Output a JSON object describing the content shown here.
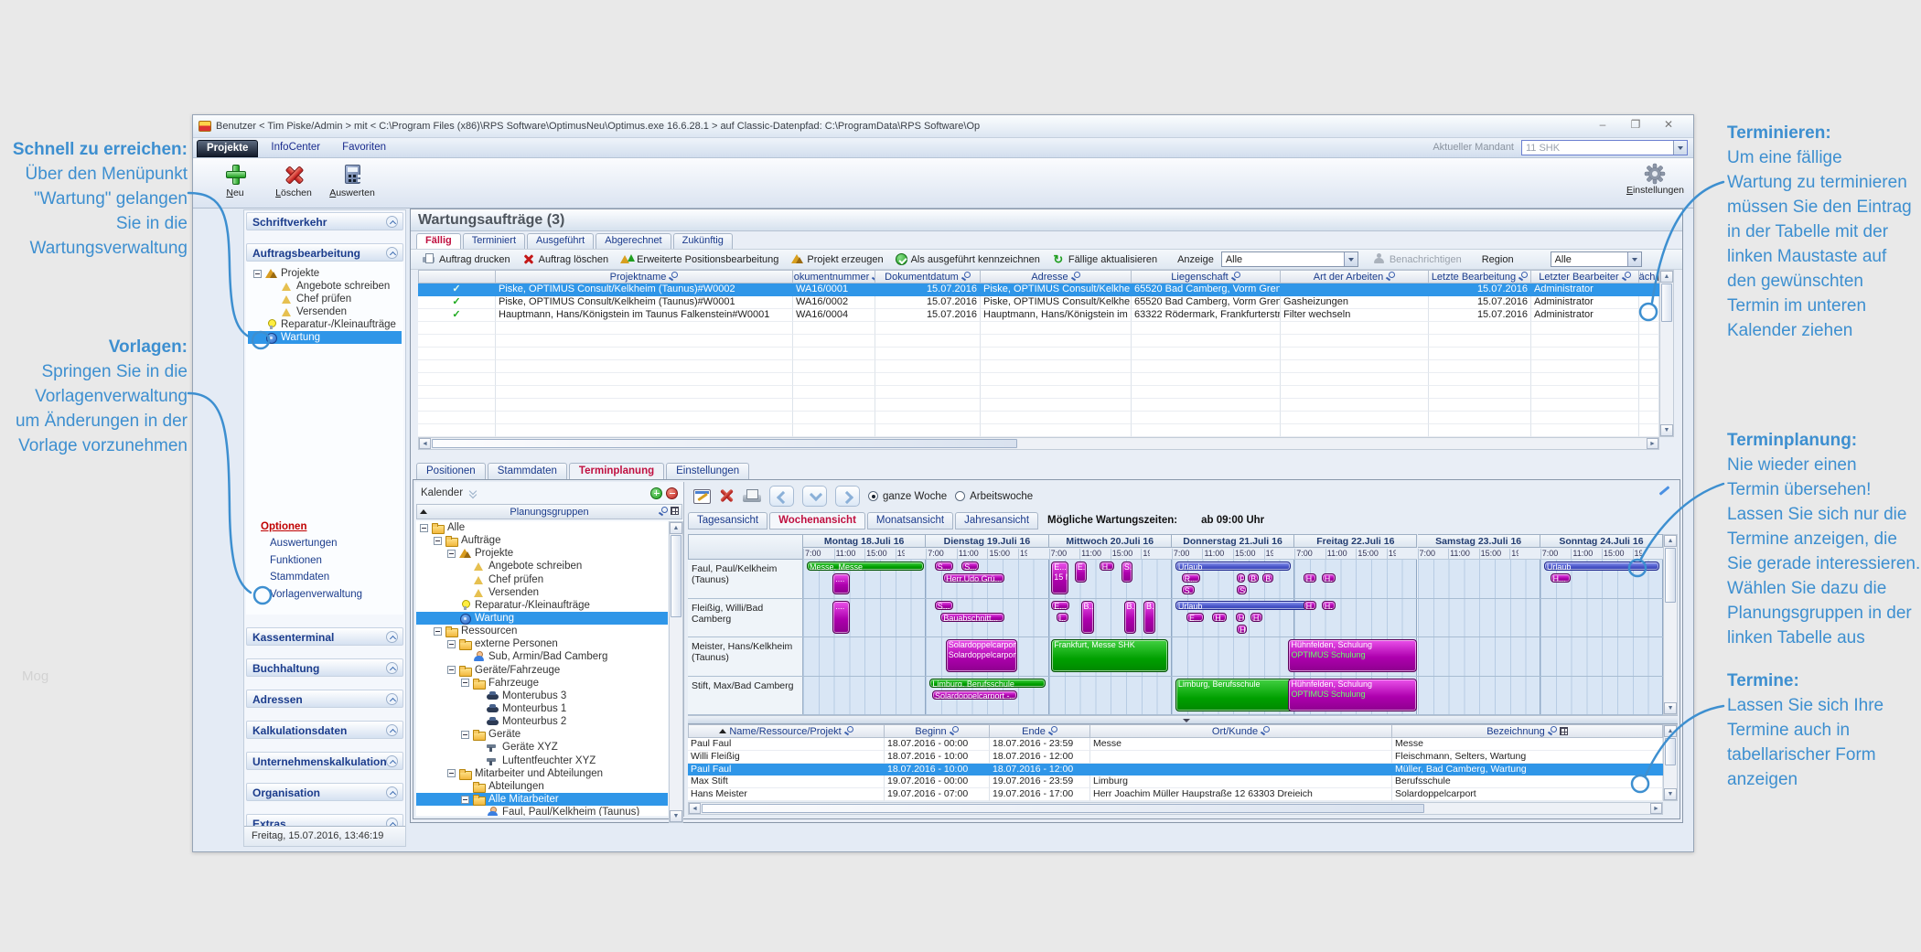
{
  "watermark": "Mog",
  "colors": {
    "annotation_blue": "#3d8fd0",
    "selection_blue": "#2f96e8",
    "active_tab_red": "#c01040",
    "event_green": "#00a000",
    "event_magenta": "#ae00ae",
    "event_vacation_blue": "#4854c8"
  },
  "annotations": {
    "left": [
      {
        "title": "Schnell zu erreichen:",
        "lines": [
          "Über den Menüpunkt",
          "\"Wartung\" gelangen",
          "Sie in die",
          "Wartungsverwaltung"
        ]
      },
      {
        "title": "Vorlagen:",
        "lines": [
          "Springen Sie in die",
          "Vorlagenverwaltung",
          "um Änderungen in der",
          "Vorlage vorzunehmen"
        ]
      }
    ],
    "right": [
      {
        "title": "Terminieren:",
        "lines": [
          "Um eine fällige",
          "Wartung zu terminieren",
          "müssen Sie den Eintrag",
          "in der Tabelle mit der",
          "linken Maustaste auf",
          "den gewünschten",
          "Termin im unteren",
          "Kalender ziehen"
        ]
      },
      {
        "title": "Terminplanung:",
        "lines": [
          "Nie wieder einen",
          "Termin übersehen!",
          "Lassen Sie sich nur die",
          "Termine anzeigen, die",
          "Sie gerade interessieren.",
          "Wählen Sie dazu die",
          "Planungsgruppen in der",
          "linken Tabelle aus"
        ]
      },
      {
        "title": "Termine:",
        "lines": [
          "Lassen Sie sich Ihre",
          "Termine auch in",
          "tabellarischer Form",
          "anzeigen"
        ]
      }
    ]
  },
  "window": {
    "title": "Benutzer < Tim Piske/Admin > mit < C:\\Program Files (x86)\\RPS Software\\OptimusNeu\\Optimus.exe 16.6.28.1 > auf Classic-Datenpfad: C:\\ProgramData\\RPS Software\\Op",
    "menu": [
      "Projekte",
      "InfoCenter",
      "Favoriten"
    ],
    "mandant_label": "Aktueller Mandant",
    "mandant_value": "11 SHK",
    "toolbar": [
      "Neu",
      "Löschen",
      "Auswerten"
    ],
    "settings_label": "Einstellungen"
  },
  "sidebar": {
    "section_top1": "Schriftverkehr",
    "section_top2": "Auftragsbearbeitung",
    "tree": [
      {
        "depth": 0,
        "icon": "project",
        "label": "Projekte",
        "expander": true
      },
      {
        "depth": 1,
        "icon": "doc",
        "label": "Angebote schreiben"
      },
      {
        "depth": 1,
        "icon": "doc",
        "label": "Chef prüfen"
      },
      {
        "depth": 1,
        "icon": "doc",
        "label": "Versenden"
      },
      {
        "depth": 0,
        "icon": "bulb",
        "label": "Reparatur-/Kleinaufträge"
      },
      {
        "depth": 0,
        "icon": "puzzle",
        "label": "Wartung",
        "selected": true
      }
    ],
    "options_title": "Optionen",
    "options": [
      "Auswertungen",
      "Funktionen",
      "Stammdaten",
      "Vorlagenverwaltung"
    ],
    "sections": [
      "Kassenterminal",
      "Buchhaltung",
      "Adressen",
      "Kalkulationsdaten",
      "Unternehmenskalkulation",
      "Organisation",
      "Extras"
    ],
    "status": "Freitag, 15.07.2016, 13:46:19"
  },
  "main": {
    "title": "Wartungsaufträge (3)",
    "filter_tabs": [
      {
        "label": "Fällig",
        "active": true
      },
      {
        "label": "Terminiert"
      },
      {
        "label": "Ausgeführt"
      },
      {
        "label": "Abgerechnet"
      },
      {
        "label": "Zukünftig"
      }
    ],
    "actions": [
      "Auftrag drucken",
      "Auftrag löschen",
      "Erweiterte Positionsbearbeitung",
      "Projekt erzeugen",
      "Als ausgeführt kennzeichnen",
      "Fällige aktualisieren"
    ],
    "anzeige_label": "Anzeige",
    "anzeige_value": "Alle",
    "benachrichtigen_label": "Benachrichtigen",
    "region_label": "Region",
    "region_value": "Alle",
    "table": {
      "columns": [
        "",
        "Projektname",
        "Dokumentnummer",
        "Dokumentdatum",
        "Adresse",
        "Liegenschaft",
        "Art der Arbeiten",
        "Letzte Bearbeitung",
        "Letzter Bearbeiter",
        "Näch"
      ],
      "rows": [
        {
          "selected": true,
          "cells": [
            "Piske, OPTIMUS Consult/Kelkheim (Taunus)#W0002",
            "WA16/0001",
            "15.07.2016",
            "Piske, OPTIMUS Consult/Kelkhe",
            "65520 Bad Camberg, Vorm Grenz",
            "",
            "15.07.2016",
            "Administrator",
            ""
          ]
        },
        {
          "cells": [
            "Piske, OPTIMUS Consult/Kelkheim (Taunus)#W0001",
            "WA16/0002",
            "15.07.2016",
            "Piske, OPTIMUS Consult/Kelkhe",
            "65520 Bad Camberg, Vorm Grenz",
            "Gasheizungen",
            "15.07.2016",
            "Administrator",
            ""
          ]
        },
        {
          "cells": [
            "Hauptmann, Hans/Königstein im Taunus Falkenstein#W0001",
            "WA16/0004",
            "15.07.2016",
            "Hauptmann, Hans/Königstein im",
            "63322 Rödermark, Frankfurterstra",
            "Filter wechseln",
            "15.07.2016",
            "Administrator",
            ""
          ]
        }
      ]
    }
  },
  "workspace": {
    "tabs": [
      {
        "label": "Positionen"
      },
      {
        "label": "Stammdaten"
      },
      {
        "label": "Terminplanung",
        "active": true
      },
      {
        "label": "Einstellungen"
      }
    ],
    "kalender_label": "Kalender",
    "groups_header": "Planungsgruppen",
    "groups_tree": [
      {
        "depth": 0,
        "icon": "folder",
        "label": "Alle",
        "expander": true
      },
      {
        "depth": 1,
        "icon": "folder",
        "label": "Aufträge",
        "expander": true
      },
      {
        "depth": 2,
        "icon": "project",
        "label": "Projekte",
        "expander": true
      },
      {
        "depth": 3,
        "icon": "doc",
        "label": "Angebote schreiben"
      },
      {
        "depth": 3,
        "icon": "doc",
        "label": "Chef prüfen"
      },
      {
        "depth": 3,
        "icon": "doc",
        "label": "Versenden"
      },
      {
        "depth": 2,
        "icon": "bulb",
        "label": "Reparatur-/Kleinaufträge"
      },
      {
        "depth": 2,
        "icon": "puzzle",
        "label": "Wartung",
        "selected": true
      },
      {
        "depth": 1,
        "icon": "folder",
        "label": "Ressourcen",
        "expander": true
      },
      {
        "depth": 2,
        "icon": "folder",
        "label": "externe Personen",
        "expander": true
      },
      {
        "depth": 3,
        "icon": "person",
        "label": "Sub, Armin/Bad Camberg"
      },
      {
        "depth": 2,
        "icon": "folder",
        "label": "Geräte/Fahrzeuge",
        "expander": true
      },
      {
        "depth": 3,
        "icon": "folder",
        "label": "Fahrzeuge",
        "expander": true
      },
      {
        "depth": 4,
        "icon": "car",
        "label": "Monterubus 3"
      },
      {
        "depth": 4,
        "icon": "car",
        "label": "Monteurbus 1"
      },
      {
        "depth": 4,
        "icon": "car",
        "label": "Monteurbus 2"
      },
      {
        "depth": 3,
        "icon": "folder",
        "label": "Geräte",
        "expander": true
      },
      {
        "depth": 4,
        "icon": "tool",
        "label": "Geräte XYZ"
      },
      {
        "depth": 4,
        "icon": "tool",
        "label": "Luftentfeuchter XYZ"
      },
      {
        "depth": 2,
        "icon": "folder",
        "label": "Mitarbeiter und Abteilungen",
        "expander": true
      },
      {
        "depth": 3,
        "icon": "folder",
        "label": "Abteilungen"
      },
      {
        "depth": 3,
        "icon": "folder",
        "label": "Alle Mitarbeiter",
        "selected": true,
        "expander": true
      },
      {
        "depth": 4,
        "icon": "person",
        "label": "Faul, Paul/Kelkheim (Taunus)"
      }
    ],
    "scheduler": {
      "radio_full": "ganze Woche",
      "radio_work": "Arbeitswoche",
      "radio_selected": "ganze Woche",
      "view_tabs": [
        {
          "label": "Tagesansicht"
        },
        {
          "label": "Wochenansicht",
          "active": true
        },
        {
          "label": "Monatsansicht"
        },
        {
          "label": "Jahresansicht"
        }
      ],
      "zeiten_label": "Mögliche Wartungszeiten:",
      "zeiten_value": "ab 09:00 Uhr",
      "days": [
        "Montag 18.Juli 16",
        "Dienstag 19.Juli 16",
        "Mittwoch 20.Juli 16",
        "Donnerstag 21.Juli 16",
        "Freitag 22.Juli 16",
        "Samstag 23.Juli 16",
        "Sonntag 24.Juli 16"
      ],
      "ticks": [
        "7:00",
        "11:00",
        "15:00",
        "19:00"
      ],
      "resources": [
        "Faul, Paul/Kelkheim (Taunus)",
        "Fleißig, Willi/Bad Camberg",
        "Meister, Hans/Kelkheim (Taunus)",
        "Stift, Max/Bad Camberg"
      ],
      "events": [
        {
          "r": 0,
          "d": 0,
          "f0": 0.03,
          "f1": 0.98,
          "l": 0,
          "s": 1,
          "c": "g",
          "t": "Messe, Messe"
        },
        {
          "r": 0,
          "d": 0,
          "f0": 0.24,
          "f1": 0.38,
          "l": 1,
          "s": 2,
          "c": "m",
          "t": "...."
        },
        {
          "r": 0,
          "d": 1,
          "f0": 0.07,
          "f1": 0.22,
          "l": 0,
          "s": 1,
          "c": "m",
          "t": "S..."
        },
        {
          "r": 0,
          "d": 1,
          "f0": 0.29,
          "f1": 0.43,
          "l": 0,
          "s": 1,
          "c": "m",
          "t": "S..."
        },
        {
          "r": 0,
          "d": 1,
          "f0": 0.14,
          "f1": 0.64,
          "l": 1,
          "s": 1,
          "c": "m",
          "t": "Herr,Udo Grü..."
        },
        {
          "r": 0,
          "d": 2,
          "f0": 0.02,
          "f1": 0.16,
          "l": 0,
          "s": 3,
          "c": "m",
          "t": "E...",
          "sub": "15 Min"
        },
        {
          "r": 0,
          "d": 2,
          "f0": 0.21,
          "f1": 0.31,
          "l": 0,
          "s": 2,
          "c": "m",
          "t": "E."
        },
        {
          "r": 0,
          "d": 2,
          "f0": 0.41,
          "f1": 0.53,
          "l": 0,
          "s": 1,
          "c": "m",
          "t": "H.."
        },
        {
          "r": 0,
          "d": 2,
          "f0": 0.59,
          "f1": 0.68,
          "l": 0,
          "s": 2,
          "c": "m",
          "t": "S."
        },
        {
          "r": 0,
          "d": 3,
          "f0": 0.03,
          "f1": 0.97,
          "l": 0,
          "s": 1,
          "c": "b",
          "t": "Urlaub"
        },
        {
          "r": 0,
          "d": 3,
          "f0": 0.08,
          "f1": 0.23,
          "l": 1,
          "s": 1,
          "c": "m",
          "t": "R..."
        },
        {
          "r": 0,
          "d": 3,
          "f0": 0.53,
          "f1": 0.6,
          "l": 1,
          "s": 1,
          "c": "m",
          "t": "F"
        },
        {
          "r": 0,
          "d": 3,
          "f0": 0.62,
          "f1": 0.71,
          "l": 1,
          "s": 1,
          "c": "m",
          "t": "B."
        },
        {
          "r": 0,
          "d": 3,
          "f0": 0.74,
          "f1": 0.83,
          "l": 1,
          "s": 1,
          "c": "m",
          "t": "B."
        },
        {
          "r": 0,
          "d": 3,
          "f0": 0.08,
          "f1": 0.19,
          "l": 2,
          "s": 1,
          "c": "m",
          "t": "S.."
        },
        {
          "r": 0,
          "d": 3,
          "f0": 0.53,
          "f1": 0.61,
          "l": 2,
          "s": 1,
          "c": "m",
          "t": "S."
        },
        {
          "r": 0,
          "d": 4,
          "f0": 0.07,
          "f1": 0.18,
          "l": 1,
          "s": 1,
          "c": "m",
          "t": "H.."
        },
        {
          "r": 0,
          "d": 4,
          "f0": 0.22,
          "f1": 0.33,
          "l": 1,
          "s": 1,
          "c": "m",
          "t": "H."
        },
        {
          "r": 0,
          "d": 6,
          "f0": 0.03,
          "f1": 0.97,
          "l": 0,
          "s": 1,
          "c": "b",
          "t": "Urlaub"
        },
        {
          "r": 0,
          "d": 6,
          "f0": 0.08,
          "f1": 0.25,
          "l": 1,
          "s": 1,
          "c": "m",
          "t": "H..."
        },
        {
          "r": 1,
          "d": 0,
          "f0": 0.24,
          "f1": 0.38,
          "l": 0,
          "s": 3,
          "c": "m",
          "t": "...."
        },
        {
          "r": 1,
          "d": 1,
          "f0": 0.07,
          "f1": 0.22,
          "l": 0,
          "s": 1,
          "c": "m",
          "t": "S..."
        },
        {
          "r": 1,
          "d": 1,
          "f0": 0.12,
          "f1": 0.64,
          "l": 1,
          "s": 1,
          "c": "m",
          "t": "Bauabschnitt..."
        },
        {
          "r": 1,
          "d": 2,
          "f0": 0.02,
          "f1": 0.17,
          "l": 0,
          "s": 1,
          "c": "m",
          "t": "E..."
        },
        {
          "r": 1,
          "d": 2,
          "f0": 0.06,
          "f1": 0.16,
          "l": 1,
          "s": 1,
          "c": "m",
          "t": "I.."
        },
        {
          "r": 1,
          "d": 2,
          "f0": 0.26,
          "f1": 0.37,
          "l": 0,
          "s": 3,
          "c": "m",
          "t": "B.."
        },
        {
          "r": 1,
          "d": 2,
          "f0": 0.61,
          "f1": 0.71,
          "l": 0,
          "s": 3,
          "c": "m",
          "t": "B."
        },
        {
          "r": 1,
          "d": 2,
          "f0": 0.77,
          "f1": 0.87,
          "l": 0,
          "s": 3,
          "c": "m",
          "t": "B."
        },
        {
          "r": 1,
          "d": 3,
          "f0": 0.03,
          "f1": 1.1,
          "l": 0,
          "s": 1,
          "c": "b",
          "t": "Urlaub"
        },
        {
          "r": 1,
          "d": 3,
          "f0": 0.12,
          "f1": 0.26,
          "l": 1,
          "s": 1,
          "c": "m",
          "t": "E..."
        },
        {
          "r": 1,
          "d": 3,
          "f0": 0.33,
          "f1": 0.45,
          "l": 1,
          "s": 1,
          "c": "m",
          "t": "H.."
        },
        {
          "r": 1,
          "d": 3,
          "f0": 0.52,
          "f1": 0.6,
          "l": 1,
          "s": 1,
          "c": "m",
          "t": "H"
        },
        {
          "r": 1,
          "d": 3,
          "f0": 0.64,
          "f1": 0.74,
          "l": 1,
          "s": 1,
          "c": "m",
          "t": "H."
        },
        {
          "r": 1,
          "d": 3,
          "f0": 0.53,
          "f1": 0.61,
          "l": 2,
          "s": 1,
          "c": "m",
          "t": "H"
        },
        {
          "r": 1,
          "d": 4,
          "f0": 0.07,
          "f1": 0.18,
          "l": 0,
          "s": 1,
          "c": "m",
          "t": "H."
        },
        {
          "r": 1,
          "d": 4,
          "f0": 0.22,
          "f1": 0.33,
          "l": 0,
          "s": 1,
          "c": "m",
          "t": "H."
        },
        {
          "r": 2,
          "d": 1,
          "f0": 0.16,
          "f1": 0.74,
          "l": 0,
          "s": 3,
          "c": "m",
          "t": "Solardoppelcarport -...",
          "sub": "Solardoppelcarport"
        },
        {
          "r": 2,
          "d": 2,
          "f0": 0.02,
          "f1": 0.97,
          "l": 0,
          "s": 3,
          "c": "g",
          "t": "Frankfurt, Messe SHK"
        },
        {
          "r": 2,
          "d": 4,
          "f0": -0.05,
          "f1": 1.0,
          "l": 0,
          "s": 3,
          "c": "m",
          "t": "Hühnfelden, Schulung",
          "sub": "OPTIMUS Schulung",
          "subgreen": true
        },
        {
          "r": 3,
          "d": 1,
          "f0": 0.03,
          "f1": 0.97,
          "l": 0,
          "s": 1,
          "c": "g",
          "t": "Limburg, Berufsschule"
        },
        {
          "r": 3,
          "d": 1,
          "f0": 0.05,
          "f1": 0.74,
          "l": 1,
          "s": 1,
          "c": "m",
          "t": "Solardoppelcarport -..."
        },
        {
          "r": 3,
          "d": 3,
          "f0": 0.03,
          "f1": 1.18,
          "l": 0,
          "s": 3,
          "c": "g",
          "t": "Limburg, Berufsschule"
        },
        {
          "r": 3,
          "d": 4,
          "f0": -0.05,
          "f1": 1.0,
          "l": 0,
          "s": 3,
          "c": "m",
          "t": "Hühnfelden, Schulung",
          "sub": "OPTIMUS Schulung",
          "subgreen": true
        }
      ]
    },
    "events_table": {
      "columns": [
        "Name/Ressource/Projekt",
        "Beginn",
        "Ende",
        "Ort/Kunde",
        "Bezeichnung"
      ],
      "rows": [
        {
          "cells": [
            "Paul Faul",
            "18.07.2016 - 00:00",
            "18.07.2016 - 23:59",
            "Messe",
            "Messe"
          ]
        },
        {
          "cells": [
            "Willi Fleißig",
            "18.07.2016 - 10:00",
            "18.07.2016 - 12:00",
            "",
            "Fleischmann, Selters, Wartung"
          ]
        },
        {
          "selected": true,
          "cells": [
            "Paul Faul",
            "18.07.2016 - 10:00",
            "18.07.2016 - 12:00",
            "",
            "Müller, Bad Camberg, Wartung"
          ]
        },
        {
          "cells": [
            "Max Stift",
            "19.07.2016 - 00:00",
            "19.07.2016 - 23:59",
            "Limburg",
            "Berufsschule"
          ]
        },
        {
          "cells": [
            "Hans Meister",
            "19.07.2016 - 07:00",
            "19.07.2016 - 17:00",
            "Herr Joachim Müller Haupstraße 12 63303 Dreieich",
            "Solardoppelcarport"
          ]
        }
      ]
    }
  }
}
